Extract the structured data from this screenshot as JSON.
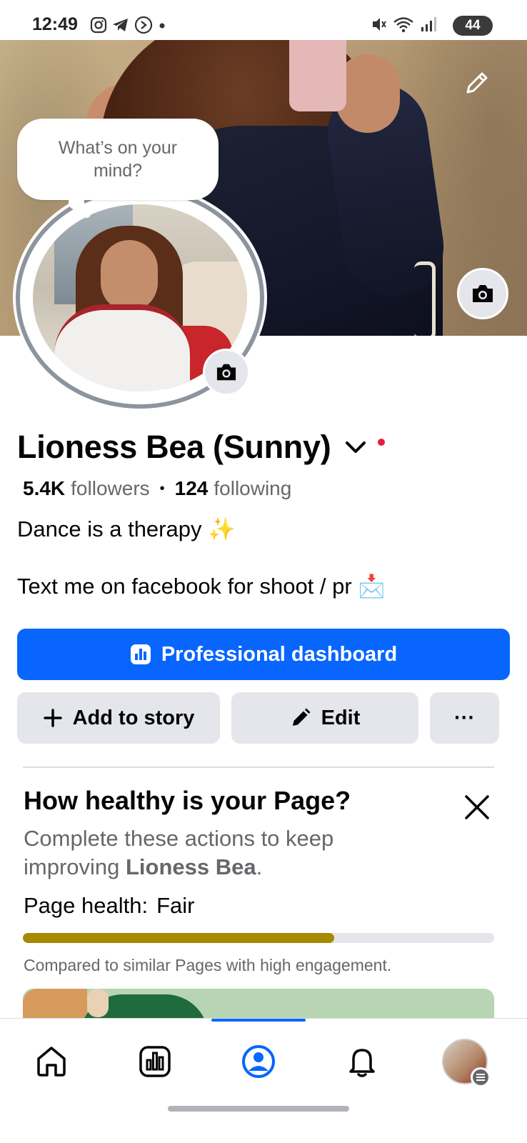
{
  "status_bar": {
    "time": "12:49",
    "battery": "44",
    "left_icons": [
      "instagram-icon",
      "telegram-icon",
      "shazam-icon",
      "dot-icon"
    ],
    "right_icons": [
      "mute-icon",
      "wifi-icon",
      "signal-icon",
      "battery-icon"
    ]
  },
  "cover": {
    "edit_icon": "pencil-icon",
    "camera_icon": "camera-icon"
  },
  "profile": {
    "thought_bubble": "What’s on your mind?",
    "name": "Lioness Bea (Sunny)",
    "followers_count": "5.4K",
    "followers_label": "followers",
    "following_count": "124",
    "following_label": "following",
    "bio_line_1": "Dance is a therapy ✨",
    "bio_line_2": "Text me on facebook for shoot / pr 📩"
  },
  "actions": {
    "professional_dashboard": "Professional dashboard",
    "add_to_story": "Add to story",
    "edit": "Edit",
    "more": "···"
  },
  "page_health": {
    "title": "How healthy is your Page?",
    "description_prefix": "Complete these actions to keep improving ",
    "description_page": "Lioness Bea",
    "description_suffix": ".",
    "status_label": "Page health:",
    "status_value": "Fair",
    "progress": 0.66,
    "progress_color": "#a68a00",
    "note": "Compared to similar Pages with high engagement."
  },
  "bottom_nav": {
    "items": [
      "home-icon",
      "dashboard-icon",
      "profile-icon",
      "notifications-icon",
      "menu-icon"
    ],
    "active": "profile-icon",
    "accent": "#0866ff"
  }
}
